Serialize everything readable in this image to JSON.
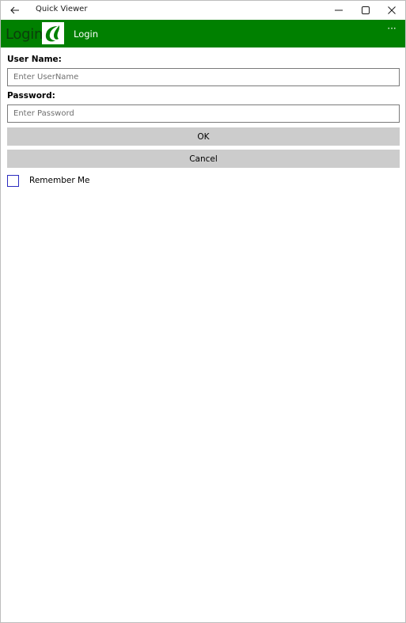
{
  "window": {
    "title": "Quick Viewer"
  },
  "appbar": {
    "logo_text": "Login",
    "page_title": "Login",
    "more_label": "···",
    "color": "#008000"
  },
  "form": {
    "username": {
      "label": "User Name:",
      "value": "",
      "placeholder": "Enter UserName"
    },
    "password": {
      "label": "Password:",
      "value": "",
      "placeholder": "Enter Password"
    },
    "ok_label": "OK",
    "cancel_label": "Cancel",
    "remember_me": {
      "label": "Remember Me",
      "checked": false
    }
  },
  "icons": {
    "back": "back-arrow-icon",
    "minimize": "minimize-icon",
    "maximize": "maximize-icon",
    "close": "close-icon",
    "logo": "leaf-logo-icon",
    "more": "more-options-icon"
  }
}
